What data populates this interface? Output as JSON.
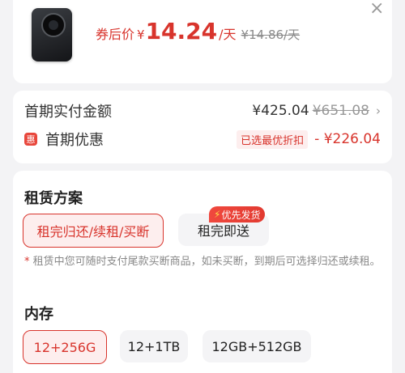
{
  "product": {
    "coupon_label": "券后价",
    "currency": "¥",
    "price": "14.24",
    "unit": "/天",
    "original": "¥14.86/天",
    "close_glyph": "×"
  },
  "payment": {
    "first_pay_label": "首期实付金额",
    "first_pay_price": "¥425.04",
    "first_pay_original": "¥651.08",
    "chevron": "›",
    "promo_icon_char": "惠",
    "promo_label": "首期优惠",
    "promo_tag": "已选最优折扣",
    "promo_discount": "- ¥226.04"
  },
  "rental_plan": {
    "title": "租赁方案",
    "options": [
      "租完归还/续租/买断",
      "租完即送"
    ],
    "selected": 0,
    "badge_icon": "⚡",
    "badge_text": "优先发货",
    "note_star": "*",
    "note": " 租赁中您可随时支付尾款买断商品，如未买断，到期后可选择归还或续租。"
  },
  "memory": {
    "title": "内存",
    "options": [
      "12+256G",
      "12+1TB",
      "12GB+512GB"
    ],
    "selected": 0
  },
  "colors": {
    "accent": "#d8342c",
    "chip_bg": "#f4f4f6",
    "page_bg": "#f3f3f5"
  }
}
